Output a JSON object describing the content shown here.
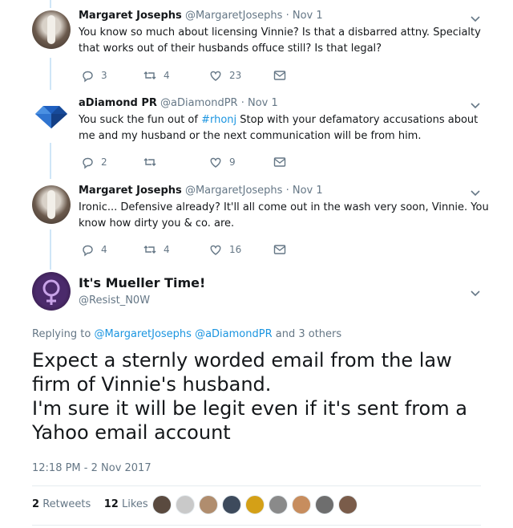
{
  "tweets": [
    {
      "name": "Margaret Josephs",
      "handle": "@MargaretJosephs",
      "sep": " · ",
      "date": "Nov 1",
      "text": "You know so much about licensing Vinnie? Is that a disbarred attny. Specialty that works out of their husbands offuce still? Is that legal?",
      "replies": "3",
      "retweets": "4",
      "likes": "23"
    },
    {
      "name": "aDiamond PR",
      "handle": "@aDiamondPR",
      "sep": " · ",
      "date": "Nov 1",
      "text_before": "You suck the fun out of ",
      "hashtag": "#rhonj",
      "text_after": " Stop with your defamatory accusations about me and my husband or the next communication will be from him.",
      "replies": "2",
      "retweets": "",
      "likes": "9"
    },
    {
      "name": "Margaret Josephs",
      "handle": "@MargaretJosephs",
      "sep": " · ",
      "date": "Nov 1",
      "text": "Ironic... Defensive already? It'll all come out in the wash very soon, Vinnie. You know how dirty you & co. are.",
      "replies": "4",
      "retweets": "4",
      "likes": "16"
    }
  ],
  "main": {
    "name": "It's Mueller Time!",
    "handle": "@Resist_N0W",
    "replying_prefix": "Replying to ",
    "replying_user1": "@MargaretJosephs",
    "replying_user2": "@aDiamondPR",
    "replying_suffix": " and 3 others",
    "text": "Expect a sternly worded email from the law firm of Vinnie's husband.\nI'm sure it will be legit even if it's sent from a Yahoo email account",
    "timestamp": "12:18 PM - 2 Nov 2017",
    "retweet_count": "2",
    "retweet_label": "Retweets",
    "like_count": "12",
    "like_label": "Likes"
  },
  "liker_colors": [
    "#5a4a3f",
    "#c9c9c9",
    "#b08d6e",
    "#3d4a5c",
    "#d4a017",
    "#8a8a8a",
    "#c78d5e",
    "#6e6e6e",
    "#7a5c4a"
  ],
  "colors": {
    "link": "#1b95e0",
    "muted": "#657786",
    "thread": "#cfe6f7"
  },
  "icons": [
    "reply-icon",
    "retweet-icon",
    "like-icon",
    "dm-icon",
    "chevron-down-icon"
  ]
}
